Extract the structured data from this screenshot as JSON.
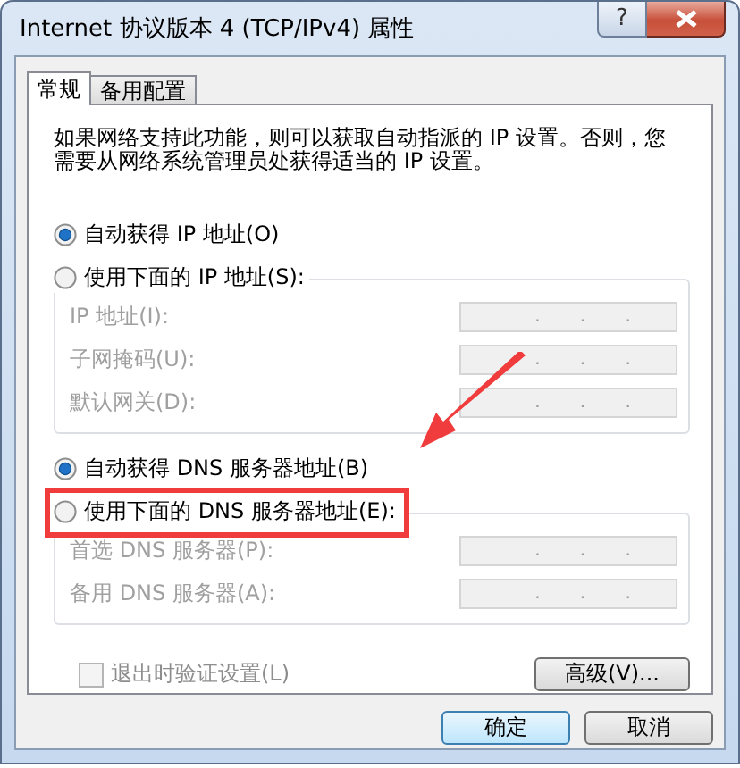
{
  "window": {
    "title": "Internet 协议版本 4 (TCP/IPv4) 属性",
    "help_label": "?"
  },
  "tabs": [
    {
      "label": "常规",
      "selected": true
    },
    {
      "label": "备用配置",
      "selected": false
    }
  ],
  "description": "如果网络支持此功能，则可以获取自动指派的 IP 设置。否则，您需要从网络系统管理员处获得适当的 IP 设置。",
  "ip_section": {
    "options": [
      {
        "label": "自动获得 IP 地址(O)",
        "selected": true,
        "highlighted": false
      },
      {
        "label": "使用下面的 IP 地址(S):",
        "selected": false,
        "highlighted": false
      }
    ],
    "fields": [
      {
        "label": "IP 地址(I):",
        "separator": ".",
        "disabled": true
      },
      {
        "label": "子网掩码(U):",
        "separator": ".",
        "disabled": true
      },
      {
        "label": "默认网关(D):",
        "separator": ".",
        "disabled": true
      }
    ]
  },
  "dns_section": {
    "options": [
      {
        "label": "自动获得 DNS 服务器地址(B)",
        "selected": true,
        "highlighted": false
      },
      {
        "label": "使用下面的 DNS 服务器地址(E):",
        "selected": false,
        "highlighted": true
      }
    ],
    "fields": [
      {
        "label": "首选 DNS 服务器(P):",
        "separator": ".",
        "disabled": true
      },
      {
        "label": "备用 DNS 服务器(A):",
        "separator": ".",
        "disabled": true
      }
    ]
  },
  "validate_checkbox": {
    "label": "退出时验证设置(L)",
    "checked": false,
    "disabled": true
  },
  "advanced_button": "高级(V)...",
  "buttons": [
    {
      "label": "确定",
      "default": true
    },
    {
      "label": "取消",
      "default": false
    }
  ],
  "annotation_arrow": true
}
